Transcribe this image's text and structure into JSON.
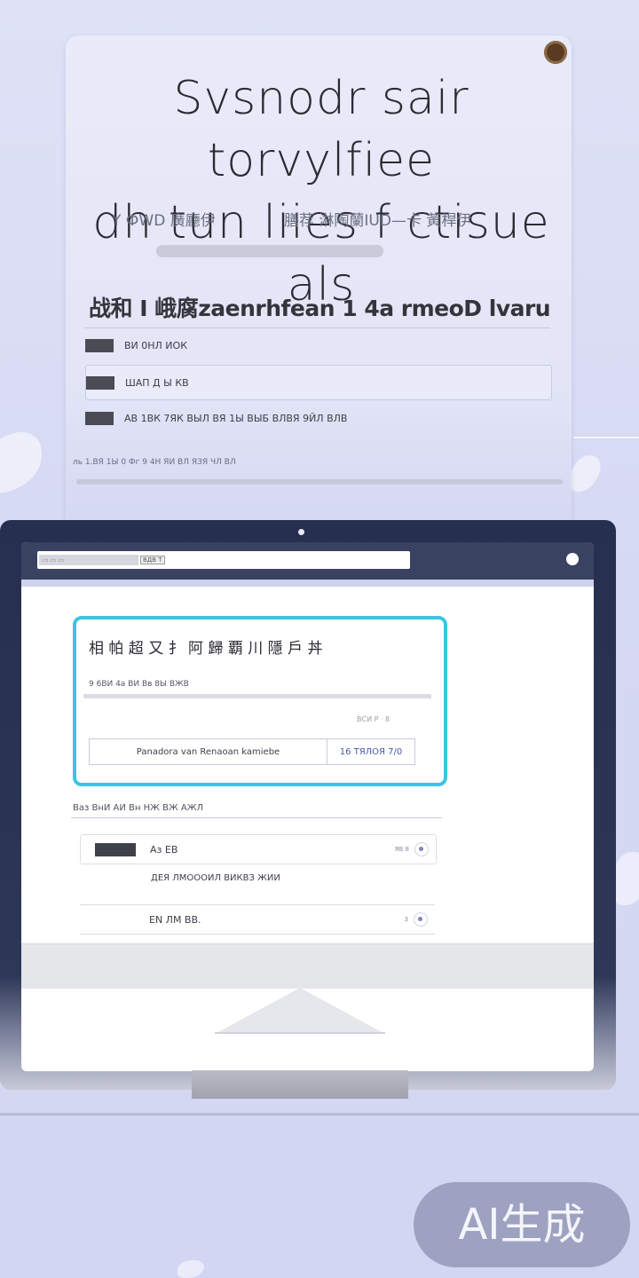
{
  "hero_card": {
    "headline_line1": "Svsnodr sair torvylfiee",
    "headline_line2": "dh tun liies f ctisue als",
    "sub_left": "Y ФWD 廣廳伊",
    "sub_right": "膳荐 淋陶蘭IUD—卡 黃桿伊",
    "section_title": "战和 I 峨腐zaenrhfean 1 4a rmeoD lvaru",
    "options": [
      {
        "label": "ВИ 0НЛ ИОК"
      },
      {
        "label": "ШАП Д Ы КВ"
      },
      {
        "label": "АВ 1ВК 7ЯК ВЫЛ ВЯ 1Ы ВЫБ ВЛВЯ 9ЙЛ ВЛВ"
      }
    ],
    "fine_print": "ль 1.ВЯ 1Ы 0 Фг 9 4Н ЯИ ВЛ ЯЗЯ ЧЛ ВЛ"
  },
  "laptop": {
    "url_tabs": "▭ ▭ ▭",
    "url_chip": "ВДВ Т",
    "callout": {
      "title": "相 帕 超 又 扌 阿 歸 覇 川 隱 戶 丼",
      "description": "9 6ВИ 4а ВИ Вв 8Ы ВЖВ",
      "counter": "ВСИ Р · 8",
      "row_text": "Panadora van Renaoan kamiebe",
      "row_button": "16 ТЯЛОЯ 7/0"
    },
    "list_heading": "Ваз ВнИ АИ Вн НЖ ВЖ АЖЛ",
    "list_items": [
      {
        "label": "Аз ЕВ",
        "value": "ЯВ 8"
      },
      {
        "label": "ЕN ЛМ ВВ.",
        "value": "3"
      }
    ],
    "list_note": "ДЕЯ ЛМОООИЛ ВИКВЗ ЖИИ"
  },
  "watermark": "AI生成",
  "colors": {
    "accent_cyan": "#3cc5e2",
    "laptop_bezel": "#262f4f",
    "background": "#d6d9f3"
  }
}
